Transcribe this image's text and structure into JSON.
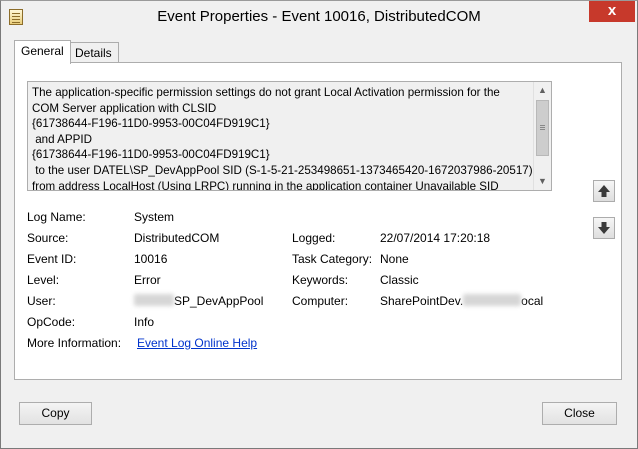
{
  "window": {
    "title": "Event Properties - Event 10016, DistributedCOM",
    "close_glyph": "x"
  },
  "tabs": [
    {
      "label": "General",
      "active": true
    },
    {
      "label": "Details",
      "active": false
    }
  ],
  "description": {
    "text": "The application-specific permission settings do not grant Local Activation permission for the\nCOM Server application with CLSID\n{61738644-F196-11D0-9953-00C04FD919C1}\n and APPID\n{61738644-F196-11D0-9953-00C04FD919C1}\n to the user DATEL\\SP_DevAppPool SID (S-1-5-21-253498651-1373465420-1672037986-20517)\nfrom address LocalHost (Using LRPC) running in the application container Unavailable SID\n(Unavailable). This security permission can be modified using the Component Services\nadministrative tool."
  },
  "fields": {
    "log_name": {
      "label": "Log Name:",
      "value": "System"
    },
    "source": {
      "label": "Source:",
      "value": "DistributedCOM"
    },
    "logged": {
      "label": "Logged:",
      "value": "22/07/2014 17:20:18"
    },
    "event_id": {
      "label": "Event ID:",
      "value": "10016"
    },
    "task_category": {
      "label": "Task Category:",
      "value": "None"
    },
    "level": {
      "label": "Level:",
      "value": "Error"
    },
    "keywords": {
      "label": "Keywords:",
      "value": "Classic"
    },
    "user": {
      "label": "User:",
      "value_visible": "SP_DevAppPool"
    },
    "computer": {
      "label": "Computer:",
      "value_prefix": "SharePointDev.",
      "value_suffix": "ocal"
    },
    "opcode": {
      "label": "OpCode:",
      "value": "Info"
    },
    "more_info": {
      "label": "More Information:",
      "link": "Event Log Online Help"
    }
  },
  "buttons": {
    "copy": "Copy",
    "close": "Close"
  },
  "colors": {
    "close_button": "#c7392b",
    "link": "#0033cc",
    "dialog_bg": "#f0f0f0"
  }
}
